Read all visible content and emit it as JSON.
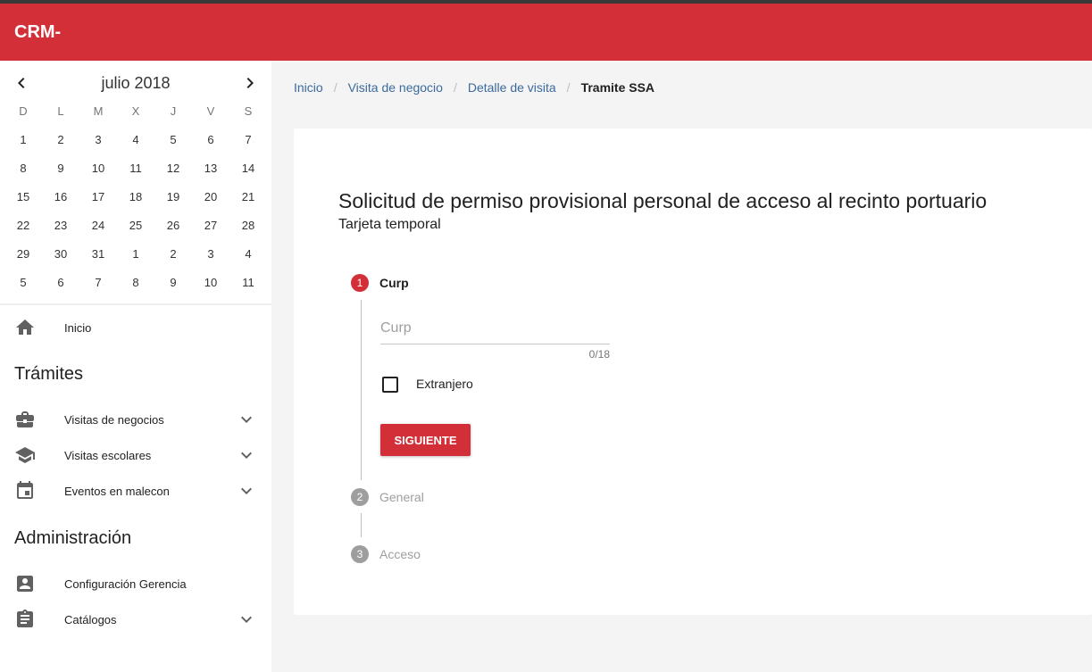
{
  "app": {
    "title": "CRM-"
  },
  "calendar": {
    "month_label": "julio 2018",
    "weekdays": [
      "D",
      "L",
      "M",
      "X",
      "J",
      "V",
      "S"
    ],
    "weeks": [
      [
        "1",
        "2",
        "3",
        "4",
        "5",
        "6",
        "7"
      ],
      [
        "8",
        "9",
        "10",
        "11",
        "12",
        "13",
        "14"
      ],
      [
        "15",
        "16",
        "17",
        "18",
        "19",
        "20",
        "21"
      ],
      [
        "22",
        "23",
        "24",
        "25",
        "26",
        "27",
        "28"
      ],
      [
        "29",
        "30",
        "31",
        "1",
        "2",
        "3",
        "4"
      ],
      [
        "5",
        "6",
        "7",
        "8",
        "9",
        "10",
        "11"
      ]
    ]
  },
  "sidebar": {
    "home": {
      "label": "Inicio",
      "icon": "home-icon"
    },
    "tramites_title": "Trámites",
    "tramites": [
      {
        "label": "Visitas de negocios",
        "icon": "briefcase-icon"
      },
      {
        "label": "Visitas escolares",
        "icon": "school-icon"
      },
      {
        "label": "Eventos en malecon",
        "icon": "calendar-event-icon"
      }
    ],
    "admin_title": "Administración",
    "admin": [
      {
        "label": "Configuración Gerencia",
        "icon": "account-box-icon"
      },
      {
        "label": "Catálogos",
        "icon": "clipboard-icon"
      }
    ]
  },
  "breadcrumb": {
    "items": [
      "Inicio",
      "Visita de negocio",
      "Detalle de visita"
    ],
    "current": "Tramite SSA",
    "separator": "/"
  },
  "form": {
    "title": "Solicitud de permiso provisional personal de acceso al recinto portuario",
    "subtitle": "Tarjeta temporal",
    "steps": [
      {
        "number": "1",
        "label": "Curp",
        "state": "active"
      },
      {
        "number": "2",
        "label": "General",
        "state": "inactive"
      },
      {
        "number": "3",
        "label": "Acceso",
        "state": "inactive"
      }
    ],
    "curp": {
      "placeholder": "Curp",
      "value": "",
      "counter": "0/18"
    },
    "foreign": {
      "label": "Extranjero",
      "checked": false
    },
    "next_label": "SIGUIENTE"
  },
  "colors": {
    "primary": "#d32f38",
    "link": "#3b6a9c",
    "inactive": "#9e9e9e"
  }
}
